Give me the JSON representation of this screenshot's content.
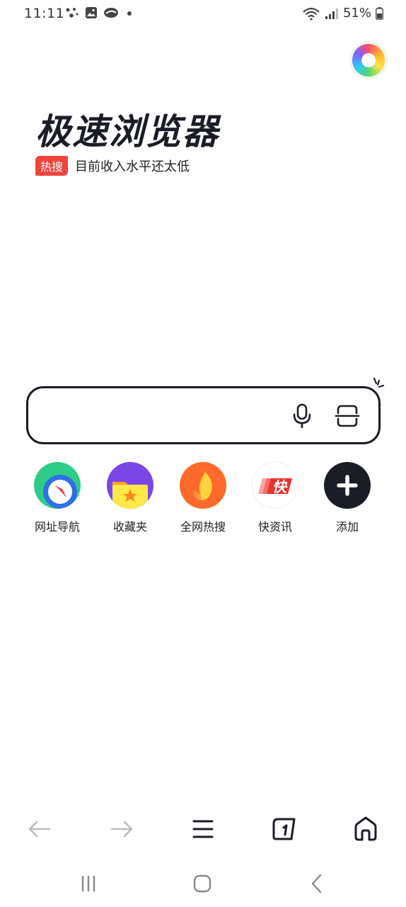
{
  "status_bar": {
    "time": "11:11",
    "battery": "51%"
  },
  "logo": {
    "title": "极速浏览器"
  },
  "hot_search": {
    "badge": "热搜",
    "text": "目前收入水平还太低"
  },
  "search": {
    "placeholder": ""
  },
  "shortcuts": [
    {
      "label": "网址导航",
      "icon": "compass-icon"
    },
    {
      "label": "收藏夹",
      "icon": "star-folder-icon"
    },
    {
      "label": "全网热搜",
      "icon": "flame-icon"
    },
    {
      "label": "快资讯",
      "icon": "kuai-news-icon"
    },
    {
      "label": "添加",
      "icon": "plus-icon"
    }
  ],
  "colors": {
    "accent_red": "#f0433c",
    "dark": "#1a1d26"
  }
}
